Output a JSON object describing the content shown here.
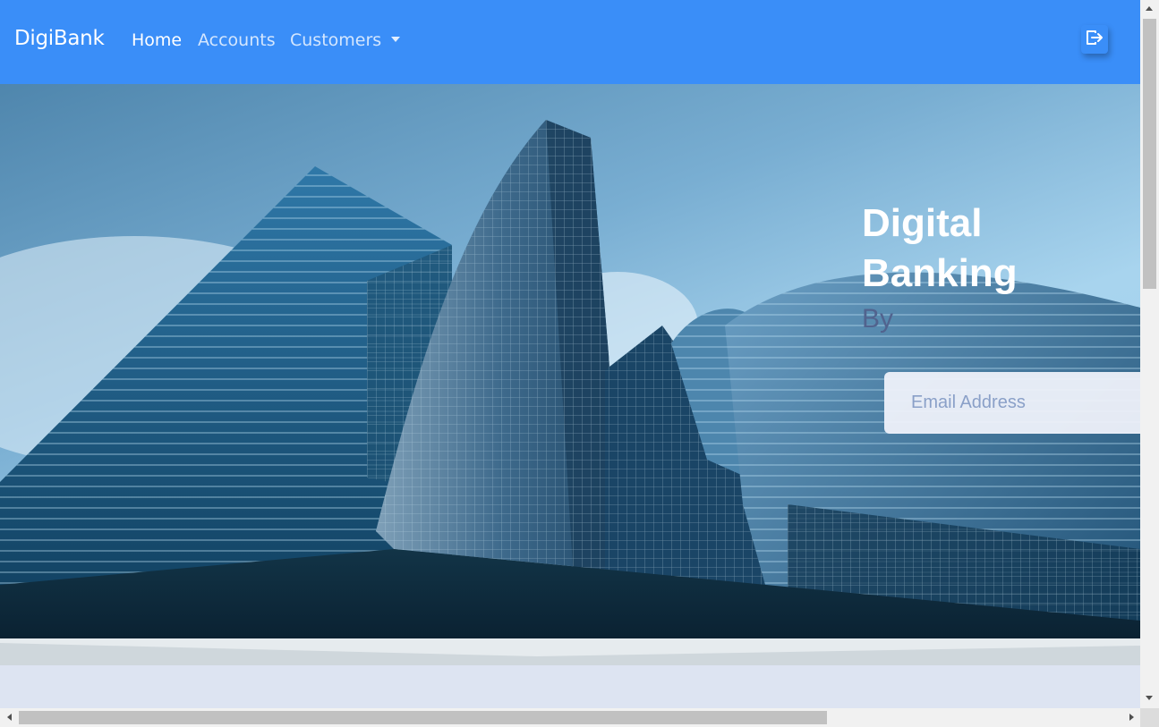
{
  "navbar": {
    "brand": "DigiBank",
    "links": [
      {
        "label": "Home",
        "active": true
      },
      {
        "label": "Accounts",
        "active": false
      },
      {
        "label": "Customers",
        "active": false,
        "dropdown": true
      }
    ],
    "logout_icon": "logout-icon",
    "background_color": "#3a8ef8"
  },
  "hero": {
    "title": "Digital Banking",
    "subtitle": "By",
    "email_placeholder": "Email Address",
    "image_subject": "skyscrapers-photo"
  },
  "page": {
    "background_color": "#dde4f2"
  }
}
